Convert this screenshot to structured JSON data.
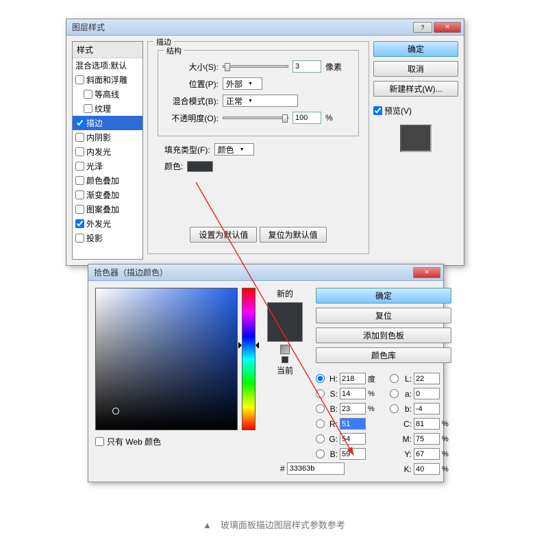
{
  "layerStyle": {
    "title": "图层样式",
    "sidebarHeader": "样式",
    "blendingOptions": "混合选项:默认",
    "items": [
      {
        "label": "斜面和浮雕",
        "checked": false
      },
      {
        "label": "等高线",
        "checked": false
      },
      {
        "label": "纹理",
        "checked": false
      },
      {
        "label": "描边",
        "checked": true,
        "selected": true
      },
      {
        "label": "内阴影",
        "checked": false
      },
      {
        "label": "内发光",
        "checked": false
      },
      {
        "label": "光泽",
        "checked": false
      },
      {
        "label": "颜色叠加",
        "checked": false
      },
      {
        "label": "渐变叠加",
        "checked": false
      },
      {
        "label": "图案叠加",
        "checked": false
      },
      {
        "label": "外发光",
        "checked": true
      },
      {
        "label": "投影",
        "checked": false
      }
    ],
    "strokeLegend": "描边",
    "structureLegend": "结构",
    "sizeLabel": "大小(S):",
    "sizeValue": "3",
    "sizeUnit": "像素",
    "positionLabel": "位置(P):",
    "positionValue": "外部",
    "blendModeLabel": "混合模式(B):",
    "blendModeValue": "正常",
    "opacityLabel": "不透明度(O):",
    "opacityValue": "100",
    "opacityUnit": "%",
    "fillTypeLabel": "填充类型(F):",
    "fillTypeValue": "颜色",
    "colorLabel": "颜色:",
    "makeDefault": "设置为默认值",
    "resetDefault": "复位为默认值",
    "ok": "确定",
    "cancel": "取消",
    "newStyle": "新建样式(W)...",
    "preview": "预览(V)"
  },
  "colorPicker": {
    "title": "拾色器（描边颜色）",
    "newLabel": "新的",
    "currentLabel": "当前",
    "ok": "确定",
    "cancel": "复位",
    "addSwatch": "添加到色板",
    "colorLibs": "颜色库",
    "onlyWeb": "只有 Web 颜色",
    "H": {
      "label": "H:",
      "value": "218",
      "unit": "度"
    },
    "S": {
      "label": "S:",
      "value": "14",
      "unit": "%"
    },
    "B": {
      "label": "B:",
      "value": "23",
      "unit": "%"
    },
    "R": {
      "label": "R:",
      "value": "51",
      "unit": ""
    },
    "G": {
      "label": "G:",
      "value": "54",
      "unit": ""
    },
    "Bv": {
      "label": "B:",
      "value": "59",
      "unit": ""
    },
    "L": {
      "label": "L:",
      "value": "22",
      "unit": ""
    },
    "a": {
      "label": "a:",
      "value": "0",
      "unit": ""
    },
    "b2": {
      "label": "b:",
      "value": "-4",
      "unit": ""
    },
    "C": {
      "label": "C:",
      "value": "81",
      "unit": "%"
    },
    "M": {
      "label": "M:",
      "value": "75",
      "unit": "%"
    },
    "Y": {
      "label": "Y:",
      "value": "67",
      "unit": "%"
    },
    "K": {
      "label": "K:",
      "value": "40",
      "unit": "%"
    },
    "hexSymbol": "#",
    "hexValue": "33363b"
  },
  "caption": "▲　玻璃面板描边图层样式参数参考"
}
